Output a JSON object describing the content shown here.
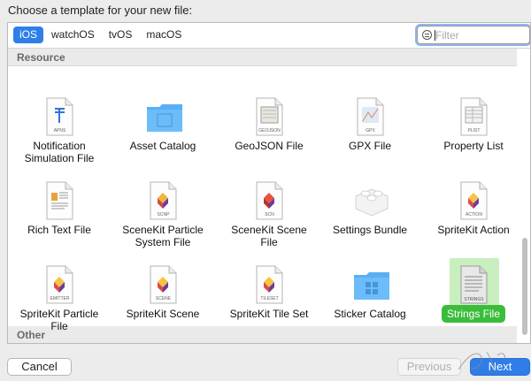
{
  "dialog": {
    "prompt": "Choose a template for your new file:",
    "platform_tabs": [
      {
        "label": "iOS",
        "active": true
      },
      {
        "label": "watchOS",
        "active": false
      },
      {
        "label": "tvOS",
        "active": false
      },
      {
        "label": "macOS",
        "active": false
      }
    ],
    "filter": {
      "value": "",
      "placeholder": "Filter"
    },
    "sections": [
      {
        "title": "Resource"
      },
      {
        "title": "Other"
      }
    ],
    "templates": [
      {
        "label": "Notification\nSimulation File",
        "icon": "apns-file-icon",
        "badge": "APNS"
      },
      {
        "label": "Asset Catalog",
        "icon": "folder-icon",
        "badge": ""
      },
      {
        "label": "GeoJSON File",
        "icon": "geojson-file-icon",
        "badge": "GEOJSON"
      },
      {
        "label": "GPX File",
        "icon": "gpx-file-icon",
        "badge": "GPX"
      },
      {
        "label": "Property List",
        "icon": "plist-file-icon",
        "badge": "PLIST"
      },
      {
        "label": "Rich Text File",
        "icon": "rtf-file-icon",
        "badge": ""
      },
      {
        "label": "SceneKit Particle\nSystem File",
        "icon": "scnp-file-icon",
        "badge": "SCNP"
      },
      {
        "label": "SceneKit Scene\nFile",
        "icon": "scn-file-icon",
        "badge": "SCN"
      },
      {
        "label": "Settings Bundle",
        "icon": "lego-brick-icon",
        "badge": ""
      },
      {
        "label": "SpriteKit Action",
        "icon": "action-file-icon",
        "badge": "ACTION"
      },
      {
        "label": "SpriteKit Particle\nFile",
        "icon": "emitter-file-icon",
        "badge": "EMITTER"
      },
      {
        "label": "SpriteKit Scene",
        "icon": "scene-file-icon",
        "badge": "SCENE"
      },
      {
        "label": "SpriteKit Tile Set",
        "icon": "tileset-file-icon",
        "badge": "TILESET"
      },
      {
        "label": "Sticker Catalog",
        "icon": "sticker-folder-icon",
        "badge": ""
      },
      {
        "label": "Strings File",
        "icon": "strings-file-icon",
        "badge": "STRINGS",
        "selected": true
      }
    ]
  },
  "footer": {
    "cancel_label": "Cancel",
    "previous_label": "Previous",
    "next_label": "Next"
  }
}
